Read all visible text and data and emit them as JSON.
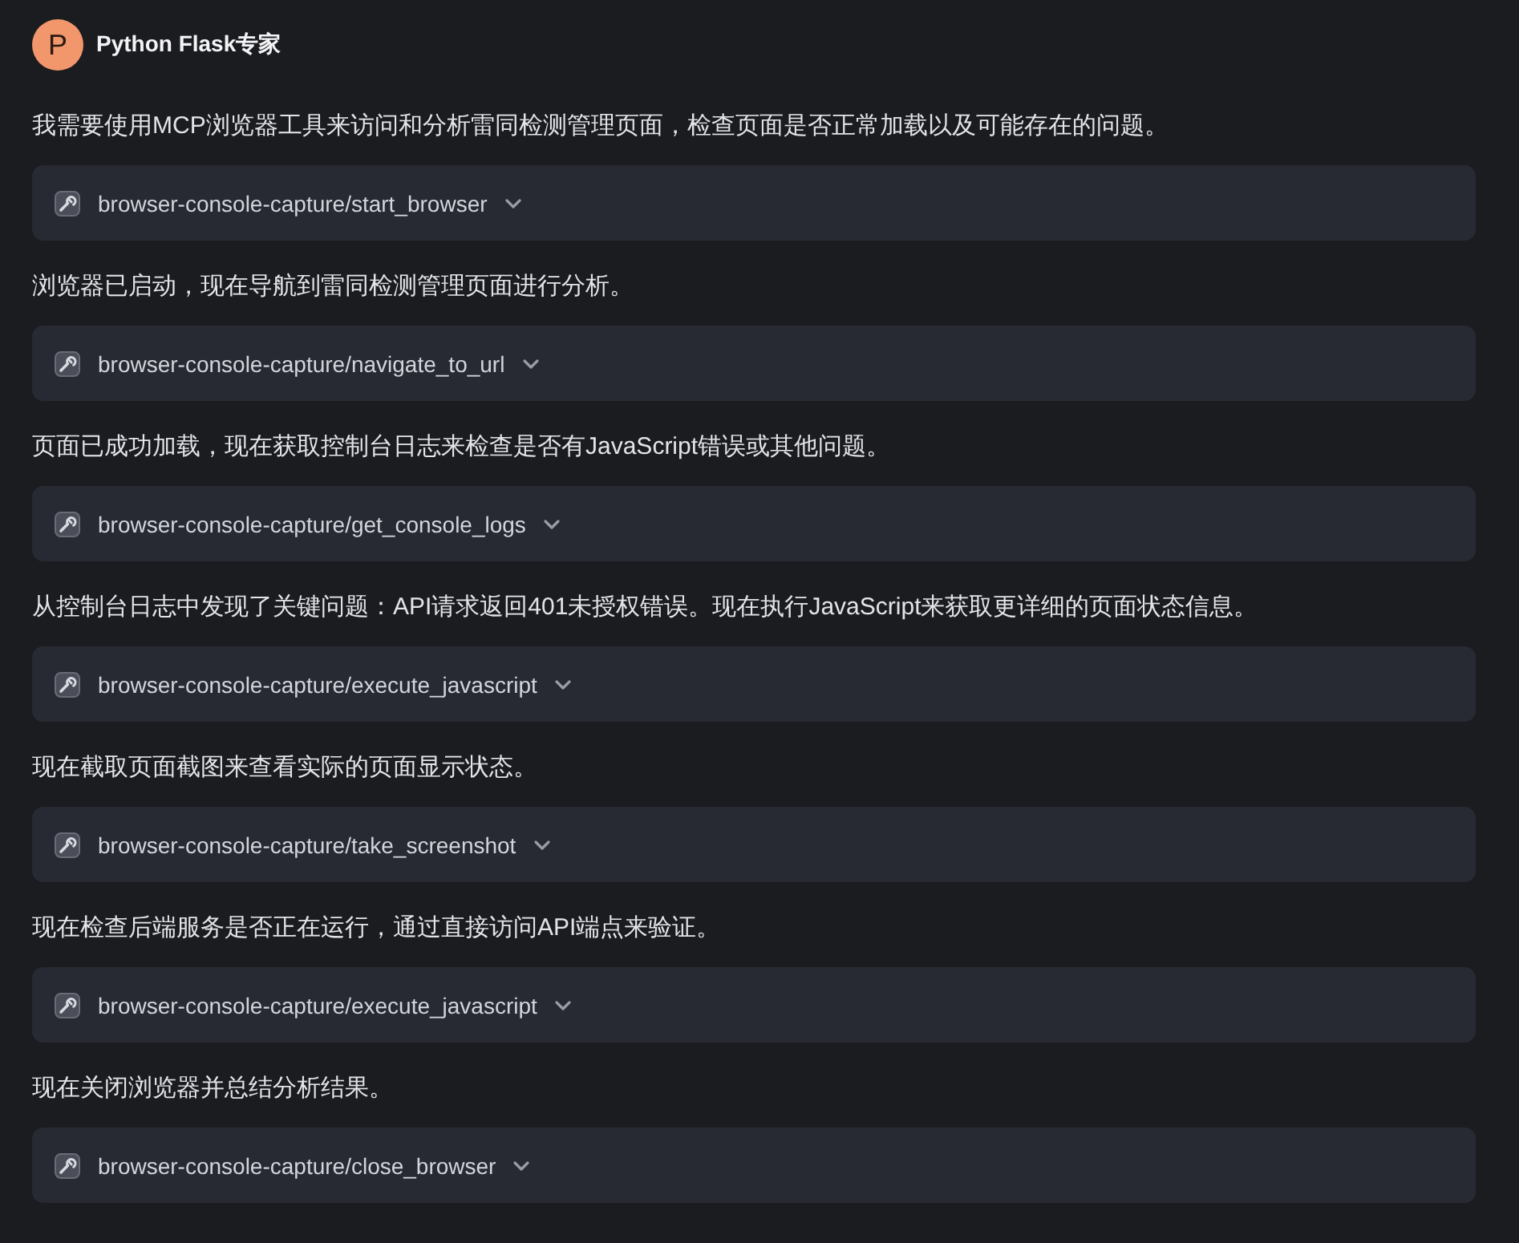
{
  "header": {
    "avatar_letter": "P",
    "name": "Python Flask专家"
  },
  "messages": [
    {
      "text": "我需要使用MCP浏览器工具来访问和分析雷同检测管理页面，检查页面是否正常加载以及可能存在的问题。",
      "tool": {
        "name": "browser-console-capture/start_browser",
        "expanded": false
      }
    },
    {
      "text": "浏览器已启动，现在导航到雷同检测管理页面进行分析。",
      "tool": {
        "name": "browser-console-capture/navigate_to_url",
        "expanded": false
      }
    },
    {
      "text": "页面已成功加载，现在获取控制台日志来检查是否有JavaScript错误或其他问题。",
      "tool": {
        "name": "browser-console-capture/get_console_logs",
        "expanded": false
      }
    },
    {
      "text": "从控制台日志中发现了关键问题：API请求返回401未授权错误。现在执行JavaScript来获取更详细的页面状态信息。",
      "tool": {
        "name": "browser-console-capture/execute_javascript",
        "expanded": false
      }
    },
    {
      "text": "现在截取页面截图来查看实际的页面显示状态。",
      "tool": {
        "name": "browser-console-capture/take_screenshot",
        "expanded": false
      }
    },
    {
      "text": "现在检查后端服务是否正在运行，通过直接访问API端点来验证。",
      "tool": {
        "name": "browser-console-capture/execute_javascript",
        "expanded": false
      }
    },
    {
      "text": "现在关闭浏览器并总结分析结果。",
      "tool": {
        "name": "browser-console-capture/close_browser",
        "expanded": false
      }
    }
  ]
}
